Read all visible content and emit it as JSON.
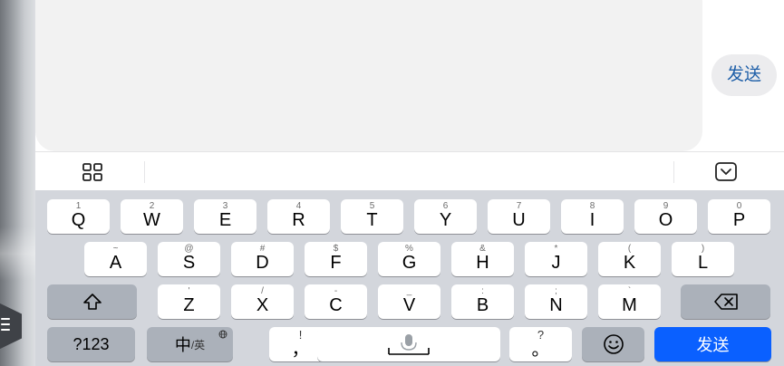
{
  "input": {
    "send_label": "发送"
  },
  "toolbar": {
    "left_icon": "grid-icon",
    "right_icon": "keyboard-collapse-icon"
  },
  "keyboard": {
    "row1": [
      {
        "main": "Q",
        "sub": "1"
      },
      {
        "main": "W",
        "sub": "2"
      },
      {
        "main": "E",
        "sub": "3"
      },
      {
        "main": "R",
        "sub": "4"
      },
      {
        "main": "T",
        "sub": "5"
      },
      {
        "main": "Y",
        "sub": "6"
      },
      {
        "main": "U",
        "sub": "7"
      },
      {
        "main": "I",
        "sub": "8"
      },
      {
        "main": "O",
        "sub": "9"
      },
      {
        "main": "P",
        "sub": "0"
      }
    ],
    "row2": [
      {
        "main": "A",
        "sub": "~"
      },
      {
        "main": "S",
        "sub": "@"
      },
      {
        "main": "D",
        "sub": "#"
      },
      {
        "main": "F",
        "sub": "$"
      },
      {
        "main": "G",
        "sub": "%"
      },
      {
        "main": "H",
        "sub": "&"
      },
      {
        "main": "J",
        "sub": "*"
      },
      {
        "main": "K",
        "sub": "("
      },
      {
        "main": "L",
        "sub": ")"
      }
    ],
    "row3": [
      {
        "main": "Z",
        "sub": "'"
      },
      {
        "main": "X",
        "sub": "/"
      },
      {
        "main": "C",
        "sub": "-"
      },
      {
        "main": "V",
        "sub": "_"
      },
      {
        "main": "B",
        "sub": ":"
      },
      {
        "main": "N",
        "sub": ";"
      },
      {
        "main": "M",
        "sub": "`"
      }
    ],
    "numbers_label": "?123",
    "lang_cn": "中",
    "lang_en": "/英",
    "comma_main": "，",
    "comma_sub": "!",
    "period_main": "。",
    "period_sub": "?",
    "send_label": "发送",
    "accent_color": "#0a60ff"
  }
}
